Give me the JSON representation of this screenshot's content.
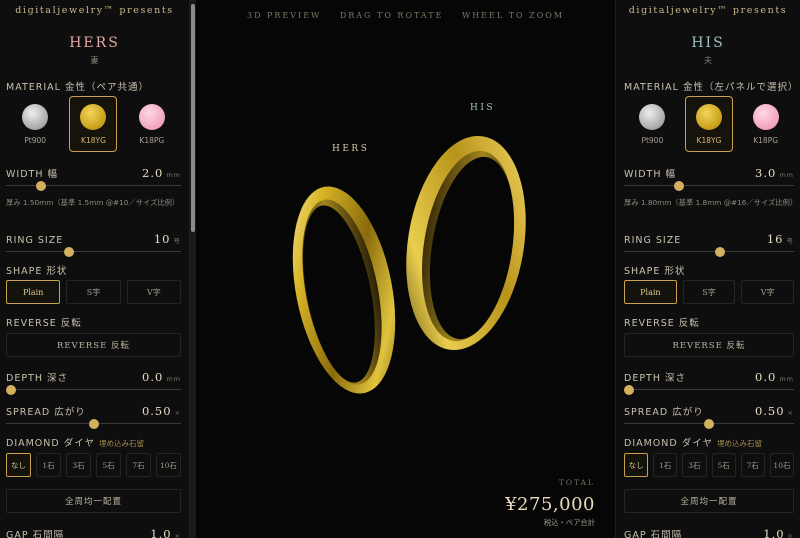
{
  "brand": "digitaljewelry™ presents",
  "left": {
    "title": "HERS",
    "subtitle": "妻",
    "material_label": "MATERIAL 金性（ペア共通）",
    "materials": [
      {
        "name": "Pt900",
        "icon": "platinum-swatch-icon"
      },
      {
        "name": "K18YG",
        "icon": "yellow-gold-swatch-icon"
      },
      {
        "name": "K18PG",
        "icon": "pink-gold-swatch-icon"
      }
    ],
    "selected_material": "K18YG",
    "width_label": "WIDTH 幅",
    "width_value": "2.0",
    "width_unit": "mm",
    "width_level": 0.18,
    "width_note": "厚み 1.50mm（基準 1.5mm @#10／サイズ比例）",
    "size_label": "RING SIZE",
    "size_value": "10",
    "size_unit": "号",
    "size_level": 0.35,
    "shape_label": "SHAPE 形状",
    "shapes": [
      "Plain",
      "S字",
      "V字"
    ],
    "selected_shape": "Plain",
    "reverse_label": "REVERSE 反転",
    "reverse_button": "REVERSE 反転",
    "depth_label": "DEPTH 深さ",
    "depth_value": "0.0",
    "depth_unit": "mm",
    "depth_level": 0.0,
    "spread_label": "SPREAD 広がり",
    "spread_value": "0.50",
    "spread_unit": "×",
    "spread_level": 0.5,
    "diamond_label": "DIAMOND ダイヤ",
    "diamond_hint": "埋め込み石留",
    "diamond_options": [
      "なし",
      "1石",
      "3石",
      "5石",
      "7石",
      "10石"
    ],
    "selected_diamond": "なし",
    "layout_button": "全周均一配置",
    "gap_label": "GAP 石間隔",
    "gap_value": "1.0",
    "gap_unit": "×"
  },
  "right": {
    "title": "HIS",
    "subtitle": "夫",
    "material_label": "MATERIAL 金性（左パネルで選択）",
    "materials": [
      {
        "name": "Pt900",
        "icon": "platinum-swatch-icon"
      },
      {
        "name": "K18YG",
        "icon": "yellow-gold-swatch-icon"
      },
      {
        "name": "K18PG",
        "icon": "pink-gold-swatch-icon"
      }
    ],
    "selected_material": "K18YG",
    "width_label": "WIDTH 幅",
    "width_value": "3.0",
    "width_unit": "mm",
    "width_level": 0.31,
    "width_note": "厚み 1.80mm（基準 1.8mm @#16／サイズ比例）",
    "size_label": "RING SIZE",
    "size_value": "16",
    "size_unit": "号",
    "size_level": 0.57,
    "shape_label": "SHAPE 形状",
    "shapes": [
      "Plain",
      "S字",
      "V字"
    ],
    "selected_shape": "Plain",
    "reverse_label": "REVERSE 反転",
    "reverse_button": "REVERSE 反転",
    "depth_label": "DEPTH 深さ",
    "depth_value": "0.0",
    "depth_unit": "mm",
    "depth_level": 0.0,
    "spread_label": "SPREAD 広がり",
    "spread_value": "0.50",
    "spread_unit": "×",
    "spread_level": 0.5,
    "diamond_label": "DIAMOND ダイヤ",
    "diamond_hint": "埋め込み石留",
    "diamond_options": [
      "なし",
      "1石",
      "3石",
      "5石",
      "7石",
      "10石"
    ],
    "selected_diamond": "なし",
    "layout_button": "全周均一配置",
    "gap_label": "GAP 石間隔",
    "gap_value": "1.0",
    "gap_unit": "×"
  },
  "preview": {
    "instructions": [
      "3D PREVIEW",
      "DRAG TO ROTATE",
      "WHEEL TO ZOOM"
    ],
    "hers_tag": "HERS",
    "his_tag": "HIS",
    "total_label": "TOTAL",
    "total_value": "¥275,000",
    "total_note": "税込・ペア合計"
  },
  "colors": {
    "gold_accent": "#c9a14a",
    "hers_title": "#e3a8a6",
    "his_title": "#9fc0c6",
    "ring_gold": "#d4b020"
  }
}
